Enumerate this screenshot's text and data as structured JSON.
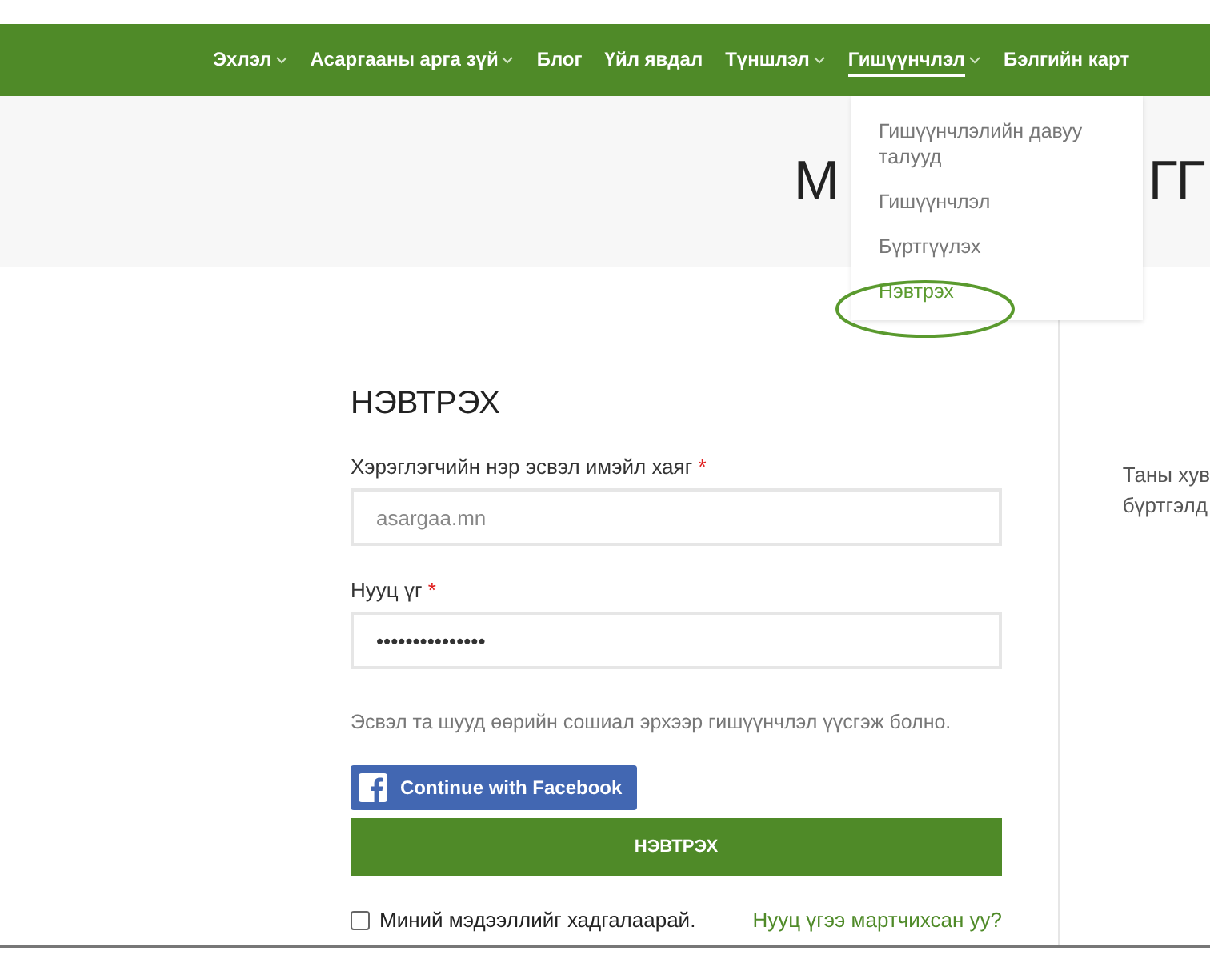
{
  "nav": {
    "items": [
      {
        "label": "Эхлэл",
        "dropdown": true,
        "selected": false
      },
      {
        "label": "Асаргааны арга зүй",
        "dropdown": true,
        "selected": false
      },
      {
        "label": "Блог",
        "dropdown": false,
        "selected": false
      },
      {
        "label": "Үйл явдал",
        "dropdown": false,
        "selected": false
      },
      {
        "label": "Түншлэл",
        "dropdown": true,
        "selected": false
      },
      {
        "label": "Гишүүнчлэл",
        "dropdown": true,
        "selected": true
      },
      {
        "label": "Бэлгийн карт",
        "dropdown": false,
        "selected": false
      }
    ]
  },
  "submenu": {
    "items": [
      {
        "label": "Гишүүнчлэлийн давуу талууд",
        "selected": false
      },
      {
        "label": "Гишүүнчлэл",
        "selected": false
      },
      {
        "label": "Бүртгүүлэх",
        "selected": false
      },
      {
        "label": "Нэвтрэх",
        "selected": true
      }
    ]
  },
  "hero": {
    "title_fragments": [
      "М",
      "ГГ"
    ]
  },
  "login": {
    "title": "НЭВТРЭХ",
    "username": {
      "label": "Хэрэглэгчийн нэр эсвэл имэйл хаяг",
      "required_mark": "*",
      "value": "asargaa.mn"
    },
    "password": {
      "label": "Нууц үг",
      "required_mark": "*",
      "value": "•••••••••••••••"
    },
    "social_text": "Эсвэл та шууд өөрийн сошиал эрхээр гишүүнчлэл үүсгэж болно.",
    "facebook_button": "Continue with Facebook",
    "submit_button": "НЭВТРЭХ",
    "remember": {
      "label": "Миний мэдээллийг хадгалаарай.",
      "checked": false
    },
    "forgot_link": "Нууц үгээ мартчихсан уу?"
  },
  "side": {
    "lines": [
      "Таны хув",
      "бүртгэлд"
    ]
  }
}
